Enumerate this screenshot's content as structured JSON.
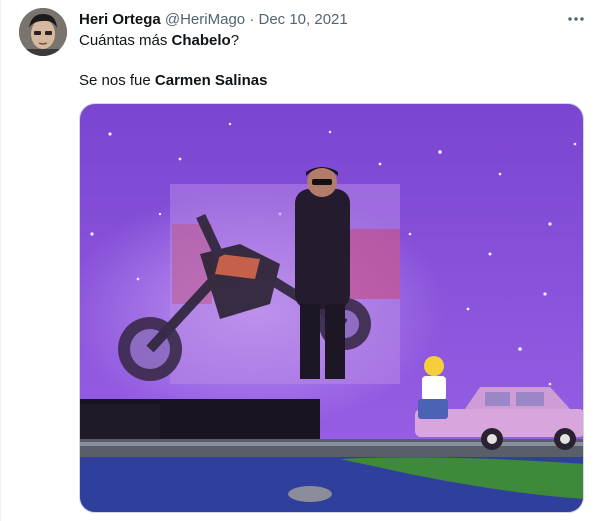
{
  "tweet": {
    "author_name": "Heri Ortega",
    "handle": "@HeriMago",
    "separator": "·",
    "date": "Dec 10, 2021",
    "line1_before": "Cuántas más ",
    "line1_bold": "Chabelo",
    "line1_after": "?",
    "line2_before": "Se nos fue ",
    "line2_bold": "Carmen Salinas"
  },
  "icons": {
    "more": "more-horizontal-icon",
    "avatar": "avatar"
  },
  "colors": {
    "text_primary": "#0f1419",
    "text_secondary": "#536471",
    "media_sky": "#8a4fd9"
  }
}
